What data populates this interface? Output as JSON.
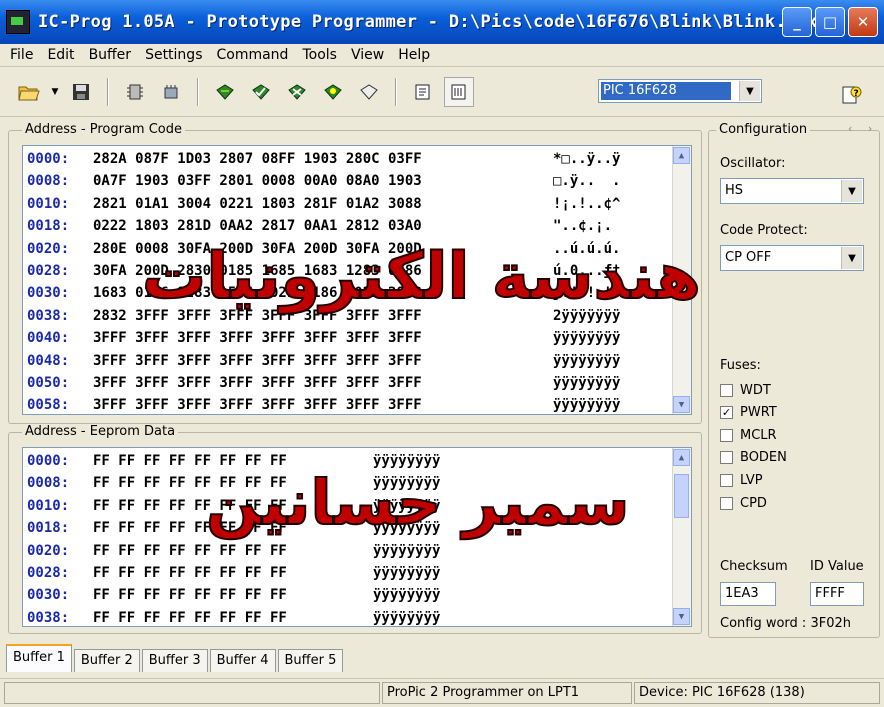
{
  "window": {
    "title": "IC-Prog 1.05A - Prototype Programmer - D:\\Pics\\code\\16F676\\Blink\\Blink.hex",
    "minimize": "_",
    "maximize": "□",
    "close": "✕"
  },
  "menu": [
    "File",
    "Edit",
    "Buffer",
    "Settings",
    "Command",
    "Tools",
    "View",
    "Help"
  ],
  "toolbar": {
    "device": "PIC 16F628"
  },
  "program_code": {
    "label": "Address - Program Code",
    "rows": [
      {
        "addr": "0000:",
        "words": "282A 087F 1D03 2807 08FF 1903 280C 03FF",
        "ascii": "*□..ÿ..ÿ"
      },
      {
        "addr": "0008:",
        "words": "0A7F 1903 03FF 2801 0008 00A0 08A0 1903",
        "ascii": "□.ÿ..  ."
      },
      {
        "addr": "0010:",
        "words": "2821 01A1 3004 0221 1803 281F 01A2 3088",
        "ascii": "!¡.!..¢^"
      },
      {
        "addr": "0018:",
        "words": "0222 1803 281D 0AA2 2817 0AA1 2812 03A0",
        "ascii": "\"..¢.¡. "
      },
      {
        "addr": "0020:",
        "words": "280E 0008 30FA 200D 30FA 200D 30FA 200D",
        "ascii": "..ú.ú.ú."
      },
      {
        "addr": "0028:",
        "words": "30FA 200D 2830 0185 1685 1683 1283 0186",
        "ascii": "ú.0...ƒ†"
      },
      {
        "addr": "0030:",
        "words": "1683 0186 1283 1586 2021 1186 2021 282B",
        "ascii": "ƒ.†.!.!+"
      },
      {
        "addr": "0038:",
        "words": "2832 3FFF 3FFF 3FFF 3FFF 3FFF 3FFF 3FFF",
        "ascii": "2ÿÿÿÿÿÿÿ"
      },
      {
        "addr": "0040:",
        "words": "3FFF 3FFF 3FFF 3FFF 3FFF 3FFF 3FFF 3FFF",
        "ascii": "ÿÿÿÿÿÿÿÿ"
      },
      {
        "addr": "0048:",
        "words": "3FFF 3FFF 3FFF 3FFF 3FFF 3FFF 3FFF 3FFF",
        "ascii": "ÿÿÿÿÿÿÿÿ"
      },
      {
        "addr": "0050:",
        "words": "3FFF 3FFF 3FFF 3FFF 3FFF 3FFF 3FFF 3FFF",
        "ascii": "ÿÿÿÿÿÿÿÿ"
      },
      {
        "addr": "0058:",
        "words": "3FFF 3FFF 3FFF 3FFF 3FFF 3FFF 3FFF 3FFF",
        "ascii": "ÿÿÿÿÿÿÿÿ"
      }
    ]
  },
  "eeprom": {
    "label": "Address - Eeprom Data",
    "rows": [
      {
        "addr": "0000:",
        "bytes": "FF FF FF FF FF FF FF FF",
        "ascii": "ÿÿÿÿÿÿÿÿ"
      },
      {
        "addr": "0008:",
        "bytes": "FF FF FF FF FF FF FF FF",
        "ascii": "ÿÿÿÿÿÿÿÿ"
      },
      {
        "addr": "0010:",
        "bytes": "FF FF FF FF FF FF FF FF",
        "ascii": "ÿÿÿÿÿÿÿÿ"
      },
      {
        "addr": "0018:",
        "bytes": "FF FF FF FF FF FF FF FF",
        "ascii": "ÿÿÿÿÿÿÿÿ"
      },
      {
        "addr": "0020:",
        "bytes": "FF FF FF FF FF FF FF FF",
        "ascii": "ÿÿÿÿÿÿÿÿ"
      },
      {
        "addr": "0028:",
        "bytes": "FF FF FF FF FF FF FF FF",
        "ascii": "ÿÿÿÿÿÿÿÿ"
      },
      {
        "addr": "0030:",
        "bytes": "FF FF FF FF FF FF FF FF",
        "ascii": "ÿÿÿÿÿÿÿÿ"
      },
      {
        "addr": "0038:",
        "bytes": "FF FF FF FF FF FF FF FF",
        "ascii": "ÿÿÿÿÿÿÿÿ"
      }
    ]
  },
  "config": {
    "title": "Configuration",
    "nav": "‹ ›",
    "oscillator_label": "Oscillator:",
    "oscillator": "HS",
    "code_protect_label": "Code Protect:",
    "code_protect": "CP OFF",
    "fuses_label": "Fuses:",
    "fuses": [
      {
        "name": "WDT",
        "checked": false
      },
      {
        "name": "PWRT",
        "checked": true
      },
      {
        "name": "MCLR",
        "checked": false
      },
      {
        "name": "BODEN",
        "checked": false
      },
      {
        "name": "LVP",
        "checked": false
      },
      {
        "name": "CPD",
        "checked": false
      }
    ],
    "checksum_label": "Checksum",
    "checksum": "1EA3",
    "id_label": "ID Value",
    "id_value": "FFFF",
    "config_word": "Config word : 3F02h"
  },
  "tabs": [
    "Buffer 1",
    "Buffer 2",
    "Buffer 3",
    "Buffer 4",
    "Buffer 5"
  ],
  "status": {
    "programmer": "ProPic 2 Programmer on LPT1",
    "device": "Device: PIC 16F628  (138)"
  },
  "watermark": {
    "line1": "هندسة الكترونيات",
    "line2": "سمير حسانين"
  },
  "colors": {
    "titlebar": "#0a5fd8",
    "address_text": "#1a2aa8",
    "selection": "#316ac5",
    "watermark": "#c00000",
    "active_tab_accent": "#f5a523"
  }
}
